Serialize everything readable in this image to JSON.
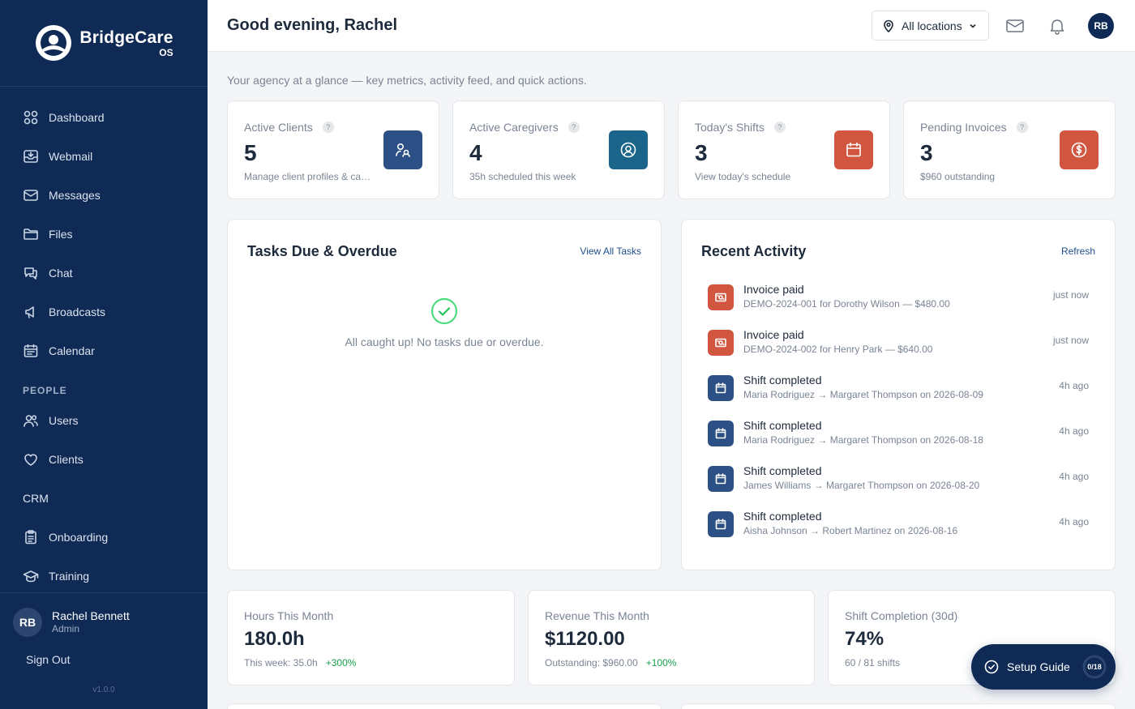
{
  "brand": {
    "name": "BridgeCare",
    "sub": "OS"
  },
  "sidebar": {
    "items": [
      {
        "label": "Dashboard",
        "icon": "grid-icon"
      },
      {
        "label": "Webmail",
        "icon": "inbox-icon"
      },
      {
        "label": "Messages",
        "icon": "mail-icon"
      },
      {
        "label": "Files",
        "icon": "folder-icon"
      },
      {
        "label": "Chat",
        "icon": "chat-icon"
      },
      {
        "label": "Broadcasts",
        "icon": "megaphone-icon"
      },
      {
        "label": "Calendar",
        "icon": "calendar-icon"
      }
    ],
    "section_people": "PEOPLE",
    "people_items": [
      {
        "label": "Users",
        "icon": "users-icon"
      },
      {
        "label": "Clients",
        "icon": "heart-icon"
      }
    ],
    "crm": "CRM",
    "more_items": [
      {
        "label": "Onboarding",
        "icon": "clipboard-icon"
      },
      {
        "label": "Training",
        "icon": "graduation-cap-icon"
      }
    ],
    "user": {
      "initials": "RB",
      "name": "Rachel Bennett",
      "role": "Admin"
    },
    "sign_out": "Sign Out",
    "version": "v1.0.0"
  },
  "header": {
    "greeting": "Good evening, Rachel",
    "location": "All locations",
    "avatar": "RB"
  },
  "subtitle": "Your agency at a glance — key metrics, activity feed, and quick actions.",
  "stats": [
    {
      "label": "Active Clients",
      "value": "5",
      "sub": "Manage client profiles & care plans",
      "color": "#2c4f86",
      "icon": "users-icon"
    },
    {
      "label": "Active Caregivers",
      "value": "4",
      "sub": "35h scheduled this week",
      "color": "#1a6589",
      "icon": "user-circle-icon"
    },
    {
      "label": "Today's Shifts",
      "value": "3",
      "sub": "View today's schedule",
      "color": "#d05640",
      "icon": "calendar-icon"
    },
    {
      "label": "Pending Invoices",
      "value": "3",
      "sub": "$960 outstanding",
      "color": "#d05640",
      "icon": "dollar-icon"
    }
  ],
  "tasks": {
    "title": "Tasks Due & Overdue",
    "link": "View All Tasks",
    "empty": "All caught up! No tasks due or overdue."
  },
  "activity": {
    "title": "Recent Activity",
    "link": "Refresh",
    "items": [
      {
        "title": "Invoice paid",
        "desc": "DEMO-2024-001 for Dorothy Wilson — $480.00",
        "time": "just now",
        "type": "invoice",
        "color": "#d05640"
      },
      {
        "title": "Invoice paid",
        "desc": "DEMO-2024-002 for Henry Park — $640.00",
        "time": "just now",
        "type": "invoice",
        "color": "#d05640"
      },
      {
        "title": "Shift completed",
        "desc": "Maria Rodriguez → Margaret Thompson on 2026-08-09",
        "time": "4h ago",
        "type": "shift",
        "color": "#2c4f86"
      },
      {
        "title": "Shift completed",
        "desc": "Maria Rodriguez → Margaret Thompson on 2026-08-18",
        "time": "4h ago",
        "type": "shift",
        "color": "#2c4f86"
      },
      {
        "title": "Shift completed",
        "desc": "James Williams → Margaret Thompson on 2026-08-20",
        "time": "4h ago",
        "type": "shift",
        "color": "#2c4f86"
      },
      {
        "title": "Shift completed",
        "desc": "Aisha Johnson → Robert Martinez on 2026-08-16",
        "time": "4h ago",
        "type": "shift",
        "color": "#2c4f86"
      }
    ]
  },
  "metrics": [
    {
      "label": "Hours This Month",
      "value": "180.0h",
      "sub": "This week: 35.0h",
      "change": "+300%"
    },
    {
      "label": "Revenue This Month",
      "value": "$1120.00",
      "sub": "Outstanding: $960.00",
      "change": "+100%"
    },
    {
      "label": "Shift Completion (30d)",
      "value": "74%",
      "sub": "60 / 81 shifts",
      "change": ""
    }
  ],
  "setup": {
    "label": "Setup Guide",
    "count": "0/18",
    "progress": 0
  }
}
